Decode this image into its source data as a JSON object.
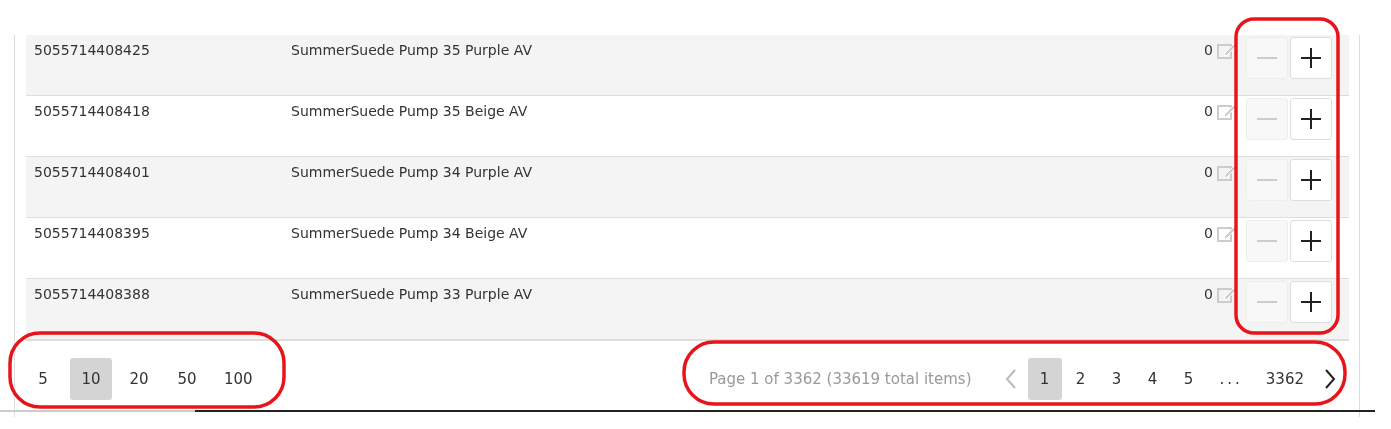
{
  "rows": [
    {
      "barcode": "5055714408425",
      "name": "SummerSuede Pump 35 Purple AV",
      "quantity": "0",
      "minus_disabled": true
    },
    {
      "barcode": "5055714408418",
      "name": "SummerSuede Pump 35 Beige AV",
      "quantity": "0",
      "minus_disabled": true
    },
    {
      "barcode": "5055714408401",
      "name": "SummerSuede Pump 34 Purple AV",
      "quantity": "0",
      "minus_disabled": true
    },
    {
      "barcode": "5055714408395",
      "name": "SummerSuede Pump 34 Beige AV",
      "quantity": "0",
      "minus_disabled": true
    },
    {
      "barcode": "5055714408388",
      "name": "SummerSuede Pump 33 Purple AV",
      "quantity": "0",
      "minus_disabled": true
    }
  ],
  "page_sizes": [
    {
      "label": "5",
      "selected": false
    },
    {
      "label": "10",
      "selected": true
    },
    {
      "label": "20",
      "selected": false
    },
    {
      "label": "50",
      "selected": false
    },
    {
      "label": "100",
      "selected": false
    }
  ],
  "pagination": {
    "summary": "Page 1 of 3362 (33619 total items)",
    "prev_disabled": true,
    "next_disabled": false,
    "pages": [
      {
        "kind": "page",
        "label": "1",
        "selected": true
      },
      {
        "kind": "page",
        "label": "2",
        "selected": false
      },
      {
        "kind": "page",
        "label": "3",
        "selected": false
      },
      {
        "kind": "page",
        "label": "4",
        "selected": false
      },
      {
        "kind": "page",
        "label": "5",
        "selected": false
      },
      {
        "kind": "ellipsis",
        "label": "...",
        "selected": false
      },
      {
        "kind": "page",
        "label": "3362",
        "selected": false
      }
    ]
  }
}
